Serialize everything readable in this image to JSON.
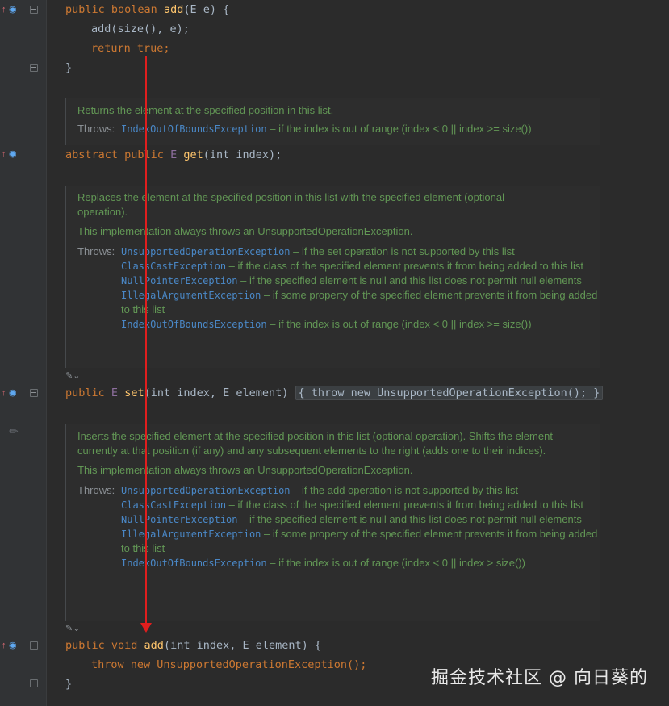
{
  "code": {
    "add_bool": {
      "mods": "public boolean",
      "name": "add",
      "params": "(E e) {"
    },
    "add_call": "add(size(), e);",
    "return_kw": "return",
    "return_val": "true;",
    "close_brace": "}",
    "get_line": {
      "mods": "abstract public",
      "type": "E",
      "name": "get",
      "params": "(int index);"
    },
    "set_line": {
      "mods": "public",
      "type": "E",
      "name": "set",
      "params": "(int index, E element)",
      "body": "{ throw new UnsupportedOperationException(); }"
    },
    "add_void": {
      "mods": "public void",
      "name": "add",
      "params": "(int index, E element) {"
    },
    "throw_line": "throw new UnsupportedOperationException();"
  },
  "docs": {
    "get": {
      "description": "Returns the element at the specified position in this list.",
      "throws_label": "Throws:",
      "throws": [
        {
          "exception": "IndexOutOfBoundsException",
          "text": " – if the index is out of range (index < 0 || index >= size())"
        }
      ]
    },
    "set": {
      "description": "Replaces the element at the specified position in this list with the specified element (optional operation).",
      "impl_note": "This implementation always throws an UnsupportedOperationException.",
      "throws_label": "Throws:",
      "throws": [
        {
          "exception": "UnsupportedOperationException",
          "text": " – if the set operation is not supported by this list"
        },
        {
          "exception": "ClassCastException",
          "text": " – if the class of the specified element prevents it from being added to this list"
        },
        {
          "exception": "NullPointerException",
          "text": " – if the specified element is null and this list does not permit null elements"
        },
        {
          "exception": "IllegalArgumentException",
          "text": " – if some property of the specified element prevents it from being added to this list"
        },
        {
          "exception": "IndexOutOfBoundsException",
          "text": " – if the index is out of range (index < 0 || index >= size())"
        }
      ]
    },
    "add": {
      "description": "Inserts the specified element at the specified position in this list (optional operation). Shifts the element currently at that position (if any) and any subsequent elements to the right (adds one to their indices).",
      "impl_note": "This implementation always throws an UnsupportedOperationException.",
      "throws_label": "Throws:",
      "throws": [
        {
          "exception": "UnsupportedOperationException",
          "text": " – if the add operation is not supported by this list"
        },
        {
          "exception": "ClassCastException",
          "text": " – if the class of the specified element prevents it from being added to this list"
        },
        {
          "exception": "NullPointerException",
          "text": " – if the specified element is null and this list does not permit null elements"
        },
        {
          "exception": "IllegalArgumentException",
          "text": " – if some property of the specified element prevents it from being added to this list"
        },
        {
          "exception": "IndexOutOfBoundsException",
          "text": " – if the index is out of range (index < 0 || index > size())"
        }
      ]
    }
  },
  "icons": {
    "override": "override-icon",
    "implements": "implements-icon",
    "fold": "fold-icon",
    "edit": "pencil-icon",
    "doc_toggle": "doc-render-toggle-icon"
  },
  "colors": {
    "background": "#2b2b2b",
    "keyword": "#cc7832",
    "method": "#ffc66d",
    "doc_text": "#629755",
    "doc_link": "#4a88c7",
    "arrow": "#e01e1e"
  },
  "watermark": "掘金技术社区 @ 向日葵的"
}
